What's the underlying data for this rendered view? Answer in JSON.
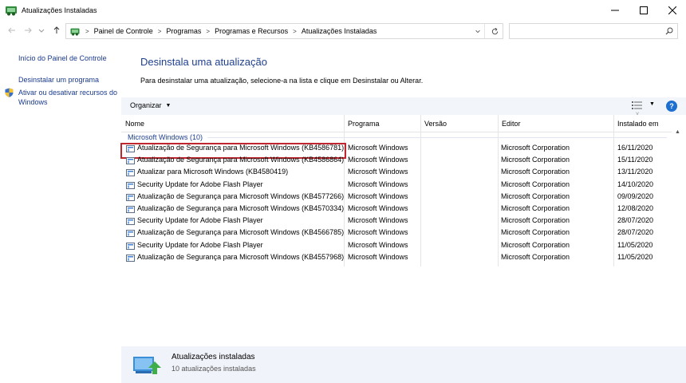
{
  "window": {
    "title": "Atualizações Instaladas"
  },
  "address": {
    "breadcrumbs": [
      "Painel de Controle",
      "Programas",
      "Programas e Recursos",
      "Atualizações Instaladas"
    ],
    "search_placeholder": ""
  },
  "sidebar": {
    "links": [
      "Início do Painel de Controle",
      "Desinstalar um programa",
      "Ativar ou desativar recursos do Windows"
    ]
  },
  "main": {
    "title": "Desinstala uma atualização",
    "description": "Para desinstalar uma atualização, selecione-a na lista e clique em Desinstalar ou Alterar."
  },
  "toolbar": {
    "organize_label": "Organizar",
    "help_label": "?"
  },
  "columns": [
    "Nome",
    "Programa",
    "Versão",
    "Editor",
    "Instalado em"
  ],
  "group": {
    "label": "Microsoft Windows (10)"
  },
  "updates": [
    {
      "name": "Atualização de Segurança para Microsoft Windows (KB4586781)",
      "program": "Microsoft Windows",
      "version": "",
      "publisher": "Microsoft Corporation",
      "installed": "16/11/2020",
      "selected": true
    },
    {
      "name": "Atualização de Segurança para Microsoft Windows (KB4586864)",
      "program": "Microsoft Windows",
      "version": "",
      "publisher": "Microsoft Corporation",
      "installed": "15/11/2020",
      "selected": false
    },
    {
      "name": "Atualizar para Microsoft Windows (KB4580419)",
      "program": "Microsoft Windows",
      "version": "",
      "publisher": "Microsoft Corporation",
      "installed": "13/11/2020",
      "selected": false
    },
    {
      "name": "Security Update for Adobe Flash Player",
      "program": "Microsoft Windows",
      "version": "",
      "publisher": "Microsoft Corporation",
      "installed": "14/10/2020",
      "selected": false
    },
    {
      "name": "Atualização de Segurança para Microsoft Windows (KB4577266)",
      "program": "Microsoft Windows",
      "version": "",
      "publisher": "Microsoft Corporation",
      "installed": "09/09/2020",
      "selected": false
    },
    {
      "name": "Atualização de Segurança para Microsoft Windows (KB4570334)",
      "program": "Microsoft Windows",
      "version": "",
      "publisher": "Microsoft Corporation",
      "installed": "12/08/2020",
      "selected": false
    },
    {
      "name": "Security Update for Adobe Flash Player",
      "program": "Microsoft Windows",
      "version": "",
      "publisher": "Microsoft Corporation",
      "installed": "28/07/2020",
      "selected": false
    },
    {
      "name": "Atualização de Segurança para Microsoft Windows (KB4566785)",
      "program": "Microsoft Windows",
      "version": "",
      "publisher": "Microsoft Corporation",
      "installed": "28/07/2020",
      "selected": false
    },
    {
      "name": "Security Update for Adobe Flash Player",
      "program": "Microsoft Windows",
      "version": "",
      "publisher": "Microsoft Corporation",
      "installed": "11/05/2020",
      "selected": false
    },
    {
      "name": "Atualização de Segurança para Microsoft Windows (KB4557968)",
      "program": "Microsoft Windows",
      "version": "",
      "publisher": "Microsoft Corporation",
      "installed": "11/05/2020",
      "selected": false
    }
  ],
  "details": {
    "title": "Atualizações instaladas",
    "subtitle": "10 atualizações instaladas"
  },
  "colors": {
    "link": "#1a3a8f",
    "heading": "#1e3f8f",
    "selection_outline": "#c0262d",
    "toolbar_bg": "#f2f6fb"
  },
  "icons": {
    "app": "control-panel-icon",
    "update": "update-package-icon",
    "shield": "uac-shield-icon",
    "search": "search-icon",
    "refresh": "refresh-icon",
    "help": "help-icon"
  }
}
